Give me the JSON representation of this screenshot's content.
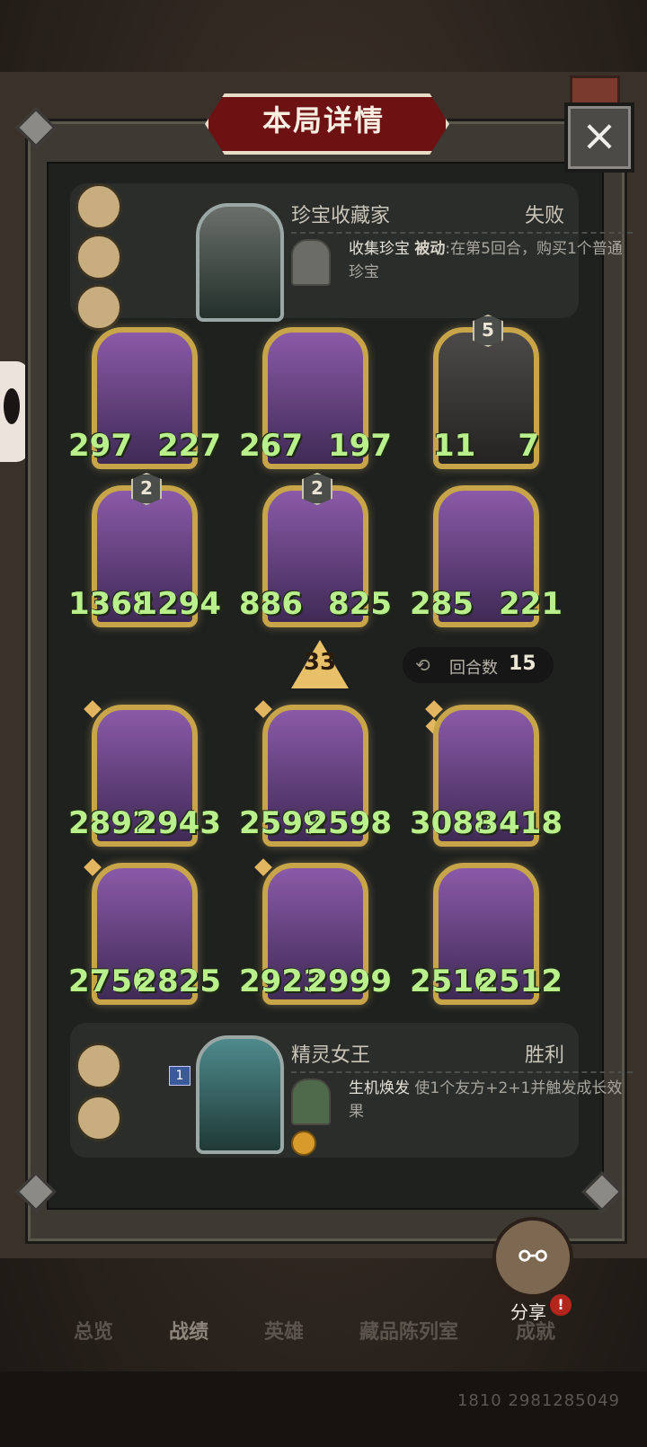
{
  "window": {
    "title": "本局详情",
    "close_icon": "×"
  },
  "opponent": {
    "name": "珍宝收藏家",
    "result": "失败",
    "skill_name": "收集珍宝",
    "skill_type": "被动",
    "skill_desc": ":在第5回合，购买1个普通珍宝"
  },
  "player": {
    "name": "精灵女王",
    "result": "胜利",
    "skill_name": "生机焕发",
    "skill_desc": "使1个友方+2+1并触发成长效果",
    "badge": "1"
  },
  "opponent_units": [
    {
      "atk": "297",
      "hp": "227",
      "level": ""
    },
    {
      "atk": "267",
      "hp": "197",
      "level": ""
    },
    {
      "atk": "11",
      "hp": "7",
      "level": "5"
    },
    {
      "atk": "1368",
      "hp": "1294",
      "level": "2"
    },
    {
      "atk": "886",
      "hp": "825",
      "level": "2"
    },
    {
      "atk": "285",
      "hp": "221",
      "level": ""
    }
  ],
  "player_units": [
    {
      "atk": "2892",
      "hp": "2943"
    },
    {
      "atk": "2599",
      "hp": "2598"
    },
    {
      "atk": "3088",
      "hp": "3418"
    },
    {
      "atk": "2756",
      "hp": "2825"
    },
    {
      "atk": "2923",
      "hp": "2999"
    },
    {
      "atk": "2516",
      "hp": "2512"
    }
  ],
  "damage_arrow": "33",
  "rounds": {
    "label": "回合数",
    "value": "15"
  },
  "share": {
    "label": "分享",
    "alert": "!"
  },
  "tabs": [
    "总览",
    "战绩",
    "英雄",
    "藏品陈列室",
    "成就"
  ],
  "footer_id": "1810 2981285049",
  "colors": {
    "stat": "#b9f08c",
    "frame_gold": "#c9a54a",
    "title_red": "#6d1113"
  }
}
